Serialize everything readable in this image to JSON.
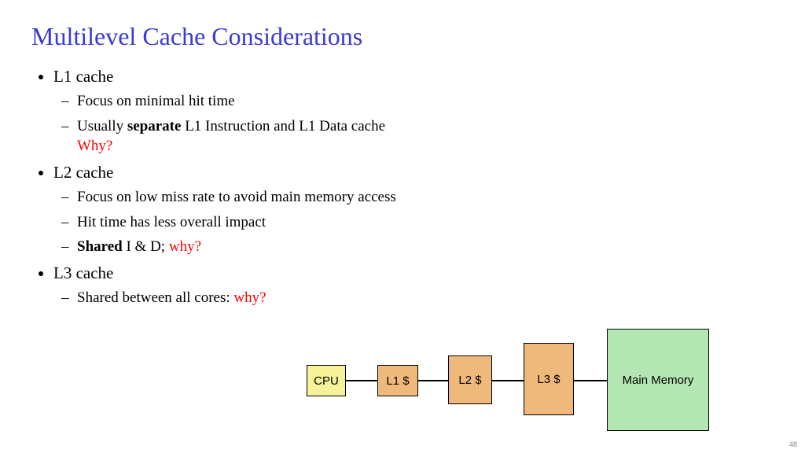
{
  "title": "Multilevel Cache Considerations",
  "bullets": {
    "l1": {
      "head": "L1 cache",
      "s1": "Focus on minimal hit time",
      "s2a": "Usually ",
      "s2b": "separate",
      "s2c": " L1 Instruction and L1 Data cache",
      "s2why": "Why?"
    },
    "l2": {
      "head": "L2 cache",
      "s1": "Focus on low miss rate to avoid main memory access",
      "s2": "Hit time has less overall impact",
      "s3a": "Shared",
      "s3b": " I & D; ",
      "s3why": "why?"
    },
    "l3": {
      "head": "L3 cache",
      "s1a": "Shared between all cores: ",
      "s1why": "why?"
    }
  },
  "diagram": {
    "cpu": "CPU",
    "l1": "L1 $",
    "l2": "L2 $",
    "l3": "L3 $",
    "mm": "Main Memory"
  },
  "pagenum": "48"
}
